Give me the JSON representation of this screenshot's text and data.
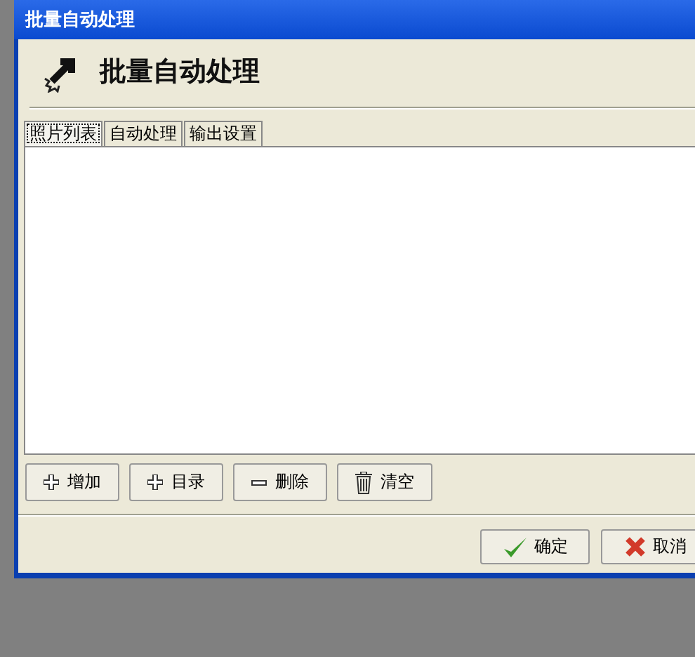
{
  "window": {
    "title": "批量自动处理"
  },
  "header": {
    "title": "批量自动处理"
  },
  "tabs": [
    {
      "label": "照片列表",
      "selected": true
    },
    {
      "label": "自动处理",
      "selected": false
    },
    {
      "label": "输出设置",
      "selected": false
    }
  ],
  "list_buttons": [
    {
      "label": "增加",
      "kind": "plus"
    },
    {
      "label": "目录",
      "kind": "plus"
    },
    {
      "label": "删除",
      "kind": "minus"
    },
    {
      "label": "清空",
      "kind": "trash"
    }
  ],
  "dialog_buttons": [
    {
      "label": "确定",
      "kind": "ok"
    },
    {
      "label": "取消",
      "kind": "cancel"
    }
  ]
}
